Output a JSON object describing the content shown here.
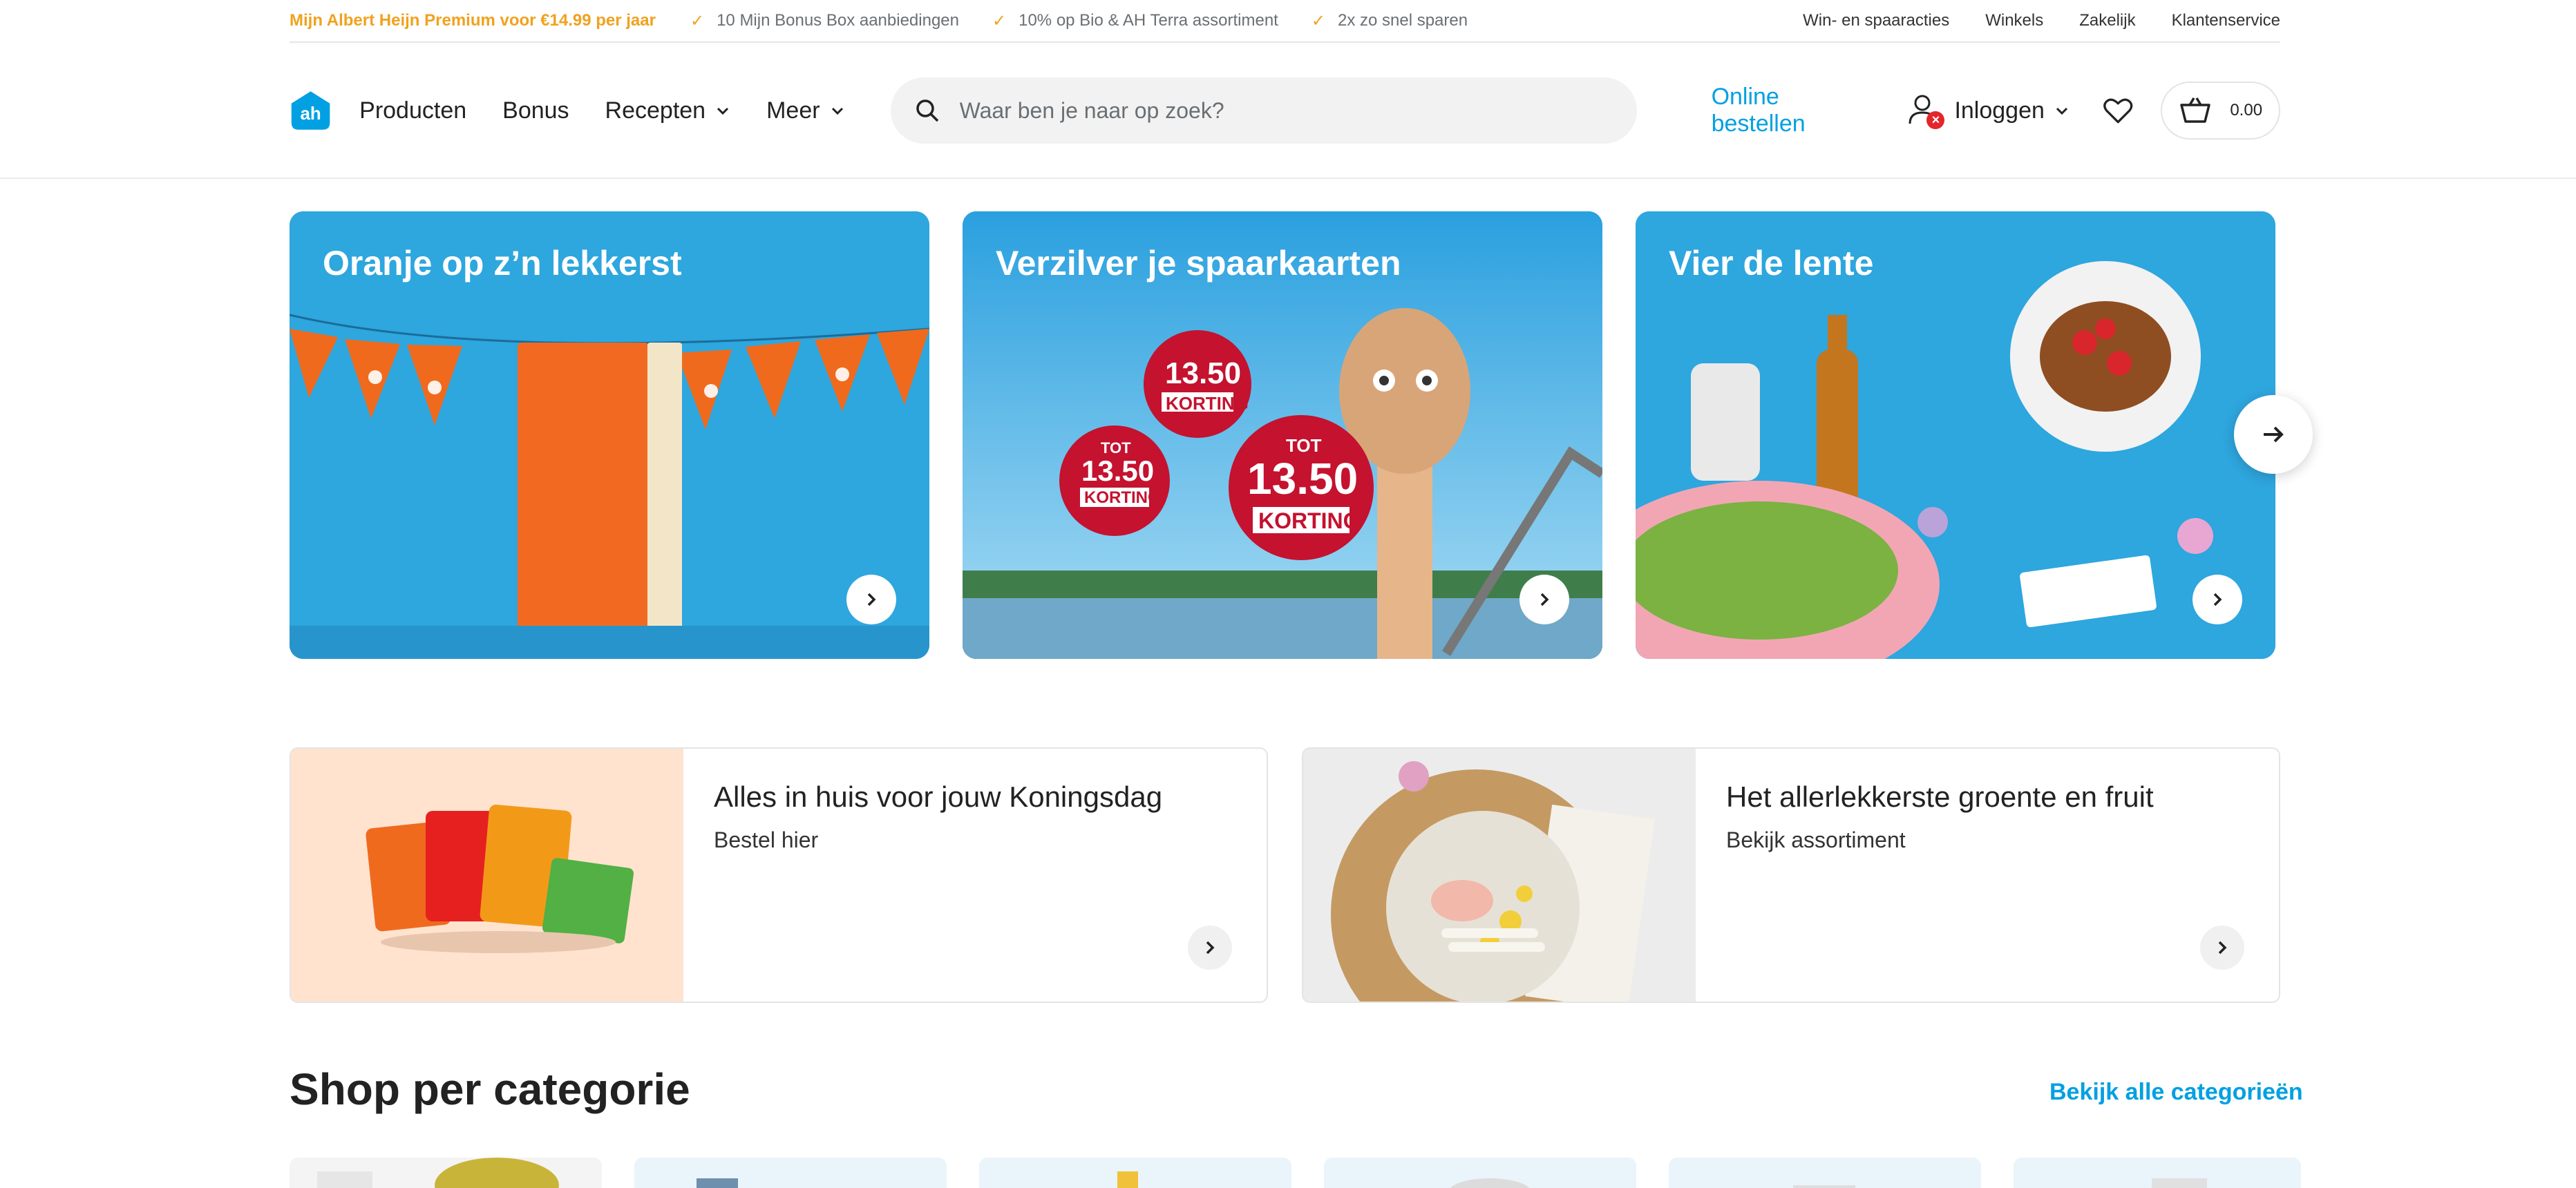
{
  "topbar": {
    "premium": "Mijn Albert Heijn Premium voor €14.99 per jaar",
    "usps": [
      "10 Mijn Bonus Box aanbiedingen",
      "10% op Bio & AH Terra assortiment",
      "2x zo snel sparen"
    ],
    "links": [
      "Win- en spaaracties",
      "Winkels",
      "Zakelijk",
      "Klantenservice"
    ]
  },
  "nav": {
    "items": [
      "Producten",
      "Bonus",
      "Recepten",
      "Meer"
    ],
    "search_placeholder": "Waar ben je naar op zoek?",
    "online": "Online bestellen",
    "login": "Inloggen",
    "cart_total": "0.00"
  },
  "hero": [
    {
      "title": "Oranje op z’n lekkerst"
    },
    {
      "title": "Verzilver je spaarkaarten",
      "badges": [
        "13.50",
        "13.50",
        "13.50"
      ],
      "badge_label": "KORTING",
      "tot": "TOT"
    },
    {
      "title": "Vier de lente"
    }
  ],
  "promos": [
    {
      "title": "Alles in huis voor jouw Koningsdag",
      "subtitle": "Bestel hier"
    },
    {
      "title": "Het allerlekkerste groente en fruit",
      "subtitle": "Bekijk assortiment"
    }
  ],
  "categories": {
    "title": "Shop per categorie",
    "link": "Bekijk alle categorieën"
  },
  "colors": {
    "accent": "#00a0e2",
    "premium": "#f0a21e",
    "hero_bg": "#2ea4dc"
  }
}
